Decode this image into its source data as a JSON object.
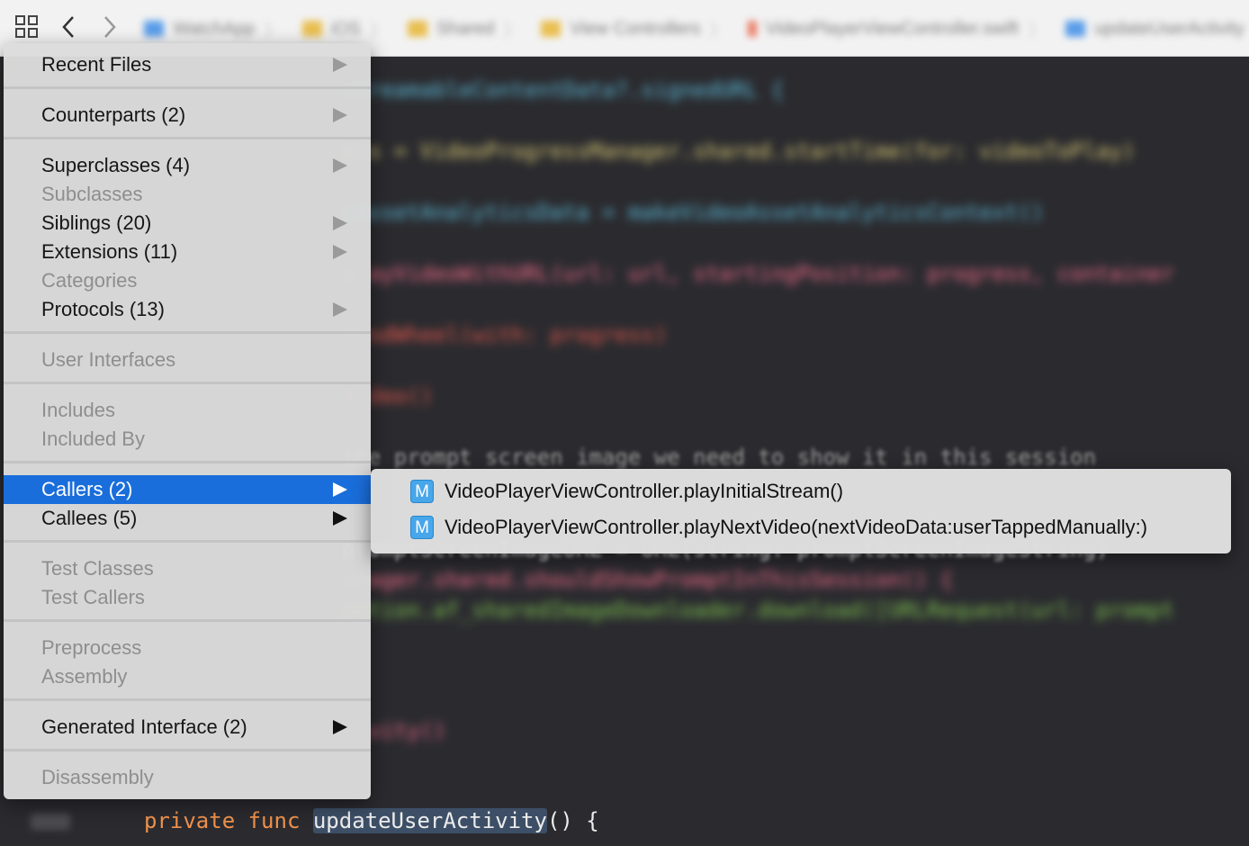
{
  "jumpbar": {
    "crumbs": [
      "WatchApp",
      "iOS",
      "Shared",
      "View Controllers",
      "VideoPlayerViewController.swift",
      "updateUserActivity"
    ]
  },
  "code": {
    "blurred_lines": [
      "streamableContentData?.signedURL {",
      "ess = VideoProgressManager.shared.startTime(for: videoToPlay)",
      "yAssetAnalyticsData = makeVideoAssetAnalyticsContext()",
      "playVideoWithURL(url: url, startingPosition: progress, container",
      "ProdWheel(with: progress)",
      "Video()",
      "the prompt screen image we need to show it in this session",
      "promptScreenImageURL = URL(string: promptScreenImageString)",
      "anager.shared.shouldShowPromptInThisSession() {",
      "eption.af_sharedImageDownloader.download([URLRequest(url: prompt",
      "tivity()"
    ],
    "visible_line": {
      "kw1": "private",
      "kw2": "func",
      "name_sel": "updateUserActivity",
      "rest": "() {"
    }
  },
  "menu": {
    "items": {
      "recent_files": "Recent Files",
      "counterparts": "Counterparts (2)",
      "superclasses": "Superclasses (4)",
      "subclasses": "Subclasses",
      "siblings": "Siblings (20)",
      "extensions": "Extensions (11)",
      "categories": "Categories",
      "protocols": "Protocols (13)",
      "user_interfaces": "User Interfaces",
      "includes": "Includes",
      "included_by": "Included By",
      "callers": "Callers (2)",
      "callees": "Callees (5)",
      "test_classes": "Test Classes",
      "test_callers": "Test Callers",
      "preprocess": "Preprocess",
      "assembly": "Assembly",
      "generated_interface": "Generated Interface (2)",
      "disassembly": "Disassembly"
    }
  },
  "submenu": {
    "badge": "M",
    "items": [
      "VideoPlayerViewController.playInitialStream()",
      "VideoPlayerViewController.playNextVideo(nextVideoData:userTappedManually:)"
    ]
  },
  "colors": {
    "highlight": "#1a6edb",
    "method_badge": "#48a6ea",
    "editor_bg": "#2b2b2f"
  }
}
